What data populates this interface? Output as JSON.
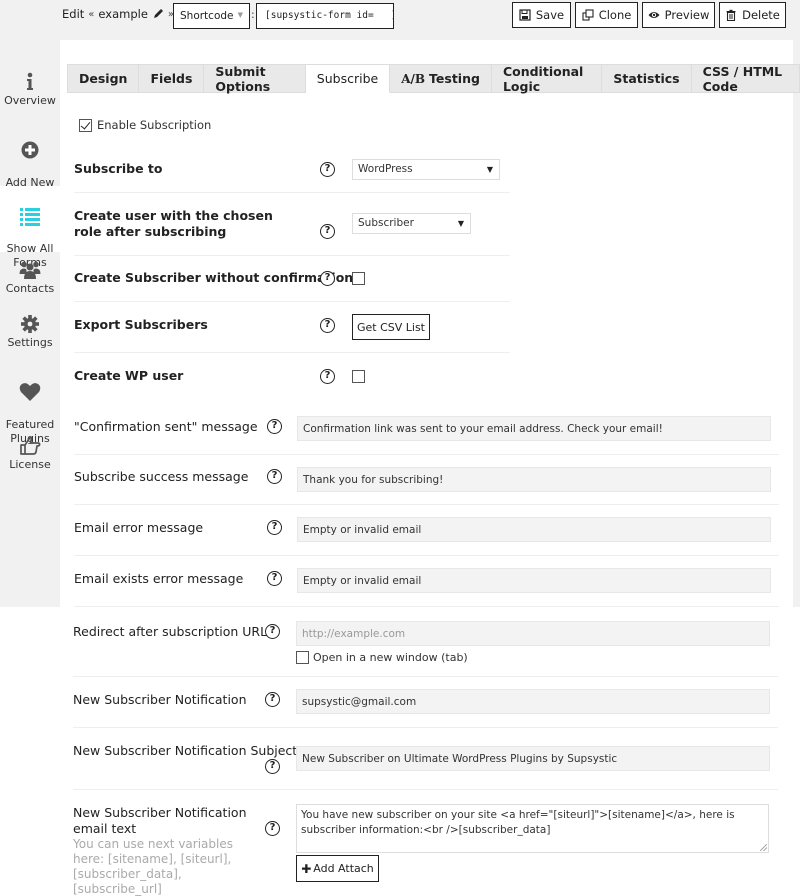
{
  "header": {
    "edit_label": "Edit",
    "breadcrumb_open": "«",
    "form_name": "example",
    "breadcrumb_close": "»",
    "shortcode_select": "Shortcode",
    "shortcode_value": "[supsystic-form id=   ]",
    "buttons": {
      "save": "Save",
      "clone": "Clone",
      "preview": "Preview",
      "delete": "Delete"
    }
  },
  "sidebar": {
    "items": [
      {
        "label": "Overview",
        "icon": "info-icon"
      },
      {
        "label": "Add New\nForm",
        "icon": "plus-circle-icon"
      },
      {
        "label": "Show All\nForms",
        "icon": "list-icon",
        "active": true
      },
      {
        "label": "Contacts",
        "icon": "users-icon"
      },
      {
        "label": "Settings",
        "icon": "gear-icon"
      },
      {
        "label": "Featured\nPlugins",
        "icon": "heart-icon"
      },
      {
        "label": "License",
        "icon": "hand-pointer-icon"
      }
    ],
    "active_color": "#2ad0e0"
  },
  "tabs": [
    {
      "label": "Design"
    },
    {
      "label": "Fields"
    },
    {
      "label": "Submit Options"
    },
    {
      "label": "Subscribe",
      "active": true
    },
    {
      "label_prefix": "A/B",
      "label": "Testing"
    },
    {
      "label": "Conditional Logic"
    },
    {
      "label": "Statistics"
    },
    {
      "label": "CSS / HTML Code"
    }
  ],
  "subscribe": {
    "enable_subscription": {
      "label": "Enable Subscription",
      "checked": true
    },
    "subscribe_to": {
      "label": "Subscribe to",
      "value": "WordPress"
    },
    "create_user_role": {
      "label": "Create user with the chosen role after subscribing",
      "value": "Subscriber"
    },
    "without_confirmation": {
      "label": "Create Subscriber without confirmation",
      "checked": false
    },
    "export": {
      "label": "Export Subscribers",
      "button": "Get CSV List"
    },
    "create_wp_user": {
      "label": "Create WP user",
      "checked": false
    },
    "confirmation_sent": {
      "label": "\"Confirmation sent\" message",
      "value": "Confirmation link was sent to your email address. Check your email!"
    },
    "success_message": {
      "label": "Subscribe success message",
      "value": "Thank you for subscribing!"
    },
    "email_error": {
      "label": "Email error message",
      "value": "Empty or invalid email"
    },
    "email_exists": {
      "label": "Email exists error message",
      "value": "Empty or invalid email"
    },
    "redirect": {
      "label": "Redirect after subscription URL",
      "placeholder": "http://example.com",
      "new_window_label": "Open in a new window (tab)",
      "new_window_checked": false
    },
    "notification": {
      "label": "New Subscriber Notification",
      "value": "supsystic@gmail.com"
    },
    "notification_subject": {
      "label": "New Subscriber Notification Subject",
      "value": "New Subscriber on Ultimate WordPress Plugins by Supsystic"
    },
    "notification_text": {
      "label": "New Subscriber Notification email text",
      "hint": "You can use next variables here: [sitename], [siteurl], [subscriber_data], [subscribe_url]",
      "value": "You have new subscriber on your site <a href=\"[siteurl]\">[sitename]</a>, here is subscriber information:<br />[subscriber_data]",
      "attach_button": "Add Attach"
    }
  }
}
